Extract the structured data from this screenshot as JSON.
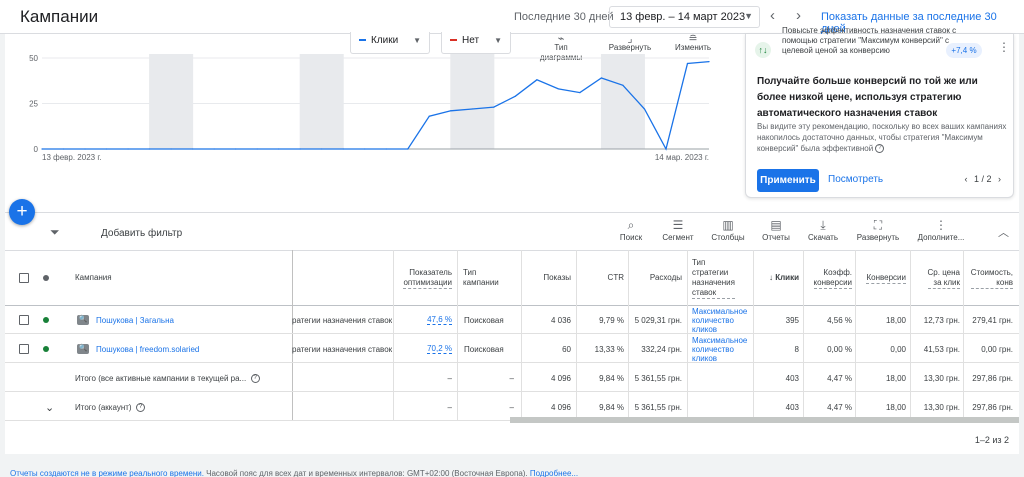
{
  "header": {
    "title": "Кампании",
    "range_label": "Последние 30 дней",
    "date_range": "13 февр. – 14 март 2023",
    "prev_icon": "chevron-left-icon",
    "next_icon": "chevron-right-icon",
    "show_last_link": "Показать данные за последние 30 дней"
  },
  "chart_controls": {
    "metric1": "Клики",
    "metric1_color": "#1a73e8",
    "metric2": "Нет",
    "metric2_color": "#d93025",
    "tools": [
      {
        "icon": "chart-type-icon",
        "label_line1": "Тип",
        "label_line2": "диаграммы"
      },
      {
        "icon": "expand-icon",
        "label_line1": "Развернуть",
        "label_line2": ""
      },
      {
        "icon": "edit-icon",
        "label_line1": "Изменить",
        "label_line2": ""
      }
    ]
  },
  "chart_data": {
    "type": "line",
    "series": [
      {
        "name": "Клики",
        "color": "#1a73e8",
        "values": [
          0,
          0,
          0,
          0,
          0,
          0,
          0,
          0,
          0,
          0,
          0,
          0,
          0,
          0,
          0,
          0,
          0,
          0,
          18,
          21,
          22,
          23,
          29,
          38,
          33,
          31,
          39,
          35,
          22,
          0,
          47,
          48
        ]
      }
    ],
    "x_start_label": "13 февр. 2023 г.",
    "x_end_label": "14 мар. 2023 г.",
    "yticks": [
      "0",
      "25",
      "50"
    ],
    "ylim": [
      0,
      50
    ],
    "weekend_bands": true,
    "grid": true
  },
  "recommendation": {
    "icon": "trend-up-icon",
    "top_text": "Повысьте эффективность назначения ставок с помощью стратегии \"Максимум конверсий\" с целевой ценой за конверсию",
    "badge": "+7,4 %",
    "more_icon": "more-vert-icon",
    "headline": "Получайте больше конверсий по той же или более низкой цене, используя стратегию автоматического назначения ставок",
    "body": "Вы видите эту рекомендацию, поскольку во всех ваших кампаниях накопилось достаточно данных, чтобы стратегия \"Максимум конверсий\" была эффективной",
    "apply": "Применить",
    "view": "Посмотреть",
    "pager": "1 / 2"
  },
  "toolbar": {
    "add_filter": "Добавить фильтр",
    "tools": [
      {
        "icon": "search-icon",
        "label": "Поиск"
      },
      {
        "icon": "segment-icon",
        "label": "Сегмент"
      },
      {
        "icon": "columns-icon",
        "label": "Столбцы"
      },
      {
        "icon": "reports-icon",
        "label": "Отчеты"
      },
      {
        "icon": "download-icon",
        "label": "Скачать"
      },
      {
        "icon": "expand-icon",
        "label": "Развернуть"
      },
      {
        "icon": "more-vert-icon",
        "label": "Дополните..."
      }
    ]
  },
  "table": {
    "headers": {
      "campaign": "Кампания",
      "opt1": "Показатель",
      "opt2": "оптимизации",
      "type1": "Тип",
      "type2": "кампании",
      "impr": "Показы",
      "ctr": "CTR",
      "cost": "Расходы",
      "bid1": "Тип",
      "bid2": "стратегии",
      "bid3": "назначения",
      "bid4": "ставок",
      "clicks": "Клики",
      "conv_rate1": "Коэфф.",
      "conv_rate2": "конверсии",
      "conv": "Конверсии",
      "cpa1": "Ср. цена",
      "cpa2": "за клик",
      "cost_conv1": "Стоимость,",
      "cost_conv2": "конв"
    },
    "rows": [
      {
        "name": "Пошукова | Загальна",
        "strategy_trunc": "ратегии назначения ставок",
        "opt": "47,6 %",
        "type": "Поисковая",
        "impr": "4 036",
        "ctr": "9,79 %",
        "cost": "5 029,31 грн.",
        "bid1": "Максимальное",
        "bid2": "количество",
        "bid3": "кликов",
        "clicks": "395",
        "conv_rate": "4,56 %",
        "conv": "18,00",
        "cpc": "12,73 грн.",
        "cost_conv": "279,41 грн."
      },
      {
        "name": "Пошукова | freedom.solaried",
        "strategy_trunc": "ратегии назначения ставок",
        "opt": "70,2 %",
        "type": "Поисковая",
        "impr": "60",
        "ctr": "13,33 %",
        "cost": "332,24 грн.",
        "bid1": "Максимальное",
        "bid2": "количество",
        "bid3": "кликов",
        "clicks": "8",
        "conv_rate": "0,00 %",
        "conv": "0,00",
        "cpc": "41,53 грн.",
        "cost_conv": "0,00 грн."
      }
    ],
    "total_active": {
      "label": "Итого (все активные кампании в текущей ра...",
      "opt": "–",
      "type": "–",
      "impr": "4 096",
      "ctr": "9,84 %",
      "cost": "5 361,55 грн.",
      "clicks": "403",
      "conv_rate": "4,47 %",
      "conv": "18,00",
      "cpc": "13,30 грн.",
      "cost_conv": "297,86 грн."
    },
    "total_account": {
      "label": "Итого (аккаунт)",
      "opt": "–",
      "type": "–",
      "impr": "4 096",
      "ctr": "9,84 %",
      "cost": "5 361,55 грн.",
      "clicks": "403",
      "conv_rate": "4,47 %",
      "conv": "18,00",
      "cpc": "13,30 грн.",
      "cost_conv": "297,86 грн."
    },
    "pagination": "1–2 из 2"
  },
  "footer": {
    "link1": "Отчеты создаются не в режиме реального времени.",
    "text": " Часовой пояс для всех дат и временных интервалов: GMT+02:00 (Восточная Европа). ",
    "link2": "Подробнее..."
  }
}
